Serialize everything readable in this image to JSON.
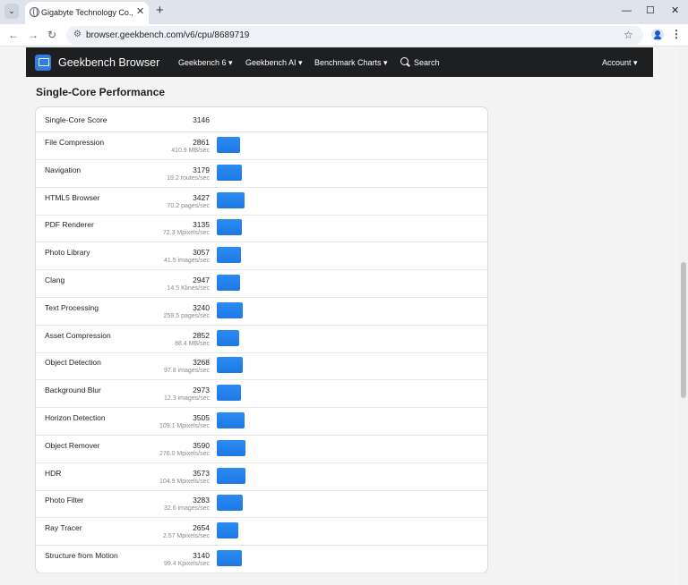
{
  "browser": {
    "tab_title": "Gigabyte Technology Co., Ltd.",
    "url": "browser.geekbench.com/v6/cpu/8689719"
  },
  "site": {
    "brand": "Geekbench Browser",
    "nav": [
      "Geekbench 6",
      "Geekbench AI",
      "Benchmark Charts",
      "Search",
      "Account"
    ]
  },
  "section_title": "Single-Core Performance",
  "score": {
    "label": "Single-Core Score",
    "value": "3146"
  },
  "bar_max": 3590,
  "rows": [
    {
      "name": "File Compression",
      "score": "2861",
      "rate": "410.9 MB/sec"
    },
    {
      "name": "Navigation",
      "score": "3179",
      "rate": "19.2 routes/sec"
    },
    {
      "name": "HTML5 Browser",
      "score": "3427",
      "rate": "70.2 pages/sec"
    },
    {
      "name": "PDF Renderer",
      "score": "3135",
      "rate": "72.3 Mpixels/sec"
    },
    {
      "name": "Photo Library",
      "score": "3057",
      "rate": "41.5 images/sec"
    },
    {
      "name": "Clang",
      "score": "2947",
      "rate": "14.5 Klines/sec"
    },
    {
      "name": "Text Processing",
      "score": "3240",
      "rate": "259.5 pages/sec"
    },
    {
      "name": "Asset Compression",
      "score": "2852",
      "rate": "88.4 MB/sec"
    },
    {
      "name": "Object Detection",
      "score": "3268",
      "rate": "97.8 images/sec"
    },
    {
      "name": "Background Blur",
      "score": "2973",
      "rate": "12.3 images/sec"
    },
    {
      "name": "Horizon Detection",
      "score": "3505",
      "rate": "109.1 Mpixels/sec"
    },
    {
      "name": "Object Remover",
      "score": "3590",
      "rate": "276.0 Mpixels/sec"
    },
    {
      "name": "HDR",
      "score": "3573",
      "rate": "104.9 Mpixels/sec"
    },
    {
      "name": "Photo Filter",
      "score": "3283",
      "rate": "32.6 images/sec"
    },
    {
      "name": "Ray Tracer",
      "score": "2654",
      "rate": "2.57 Mpixels/sec"
    },
    {
      "name": "Structure from Motion",
      "score": "3140",
      "rate": "99.4 Kpixels/sec"
    }
  ]
}
